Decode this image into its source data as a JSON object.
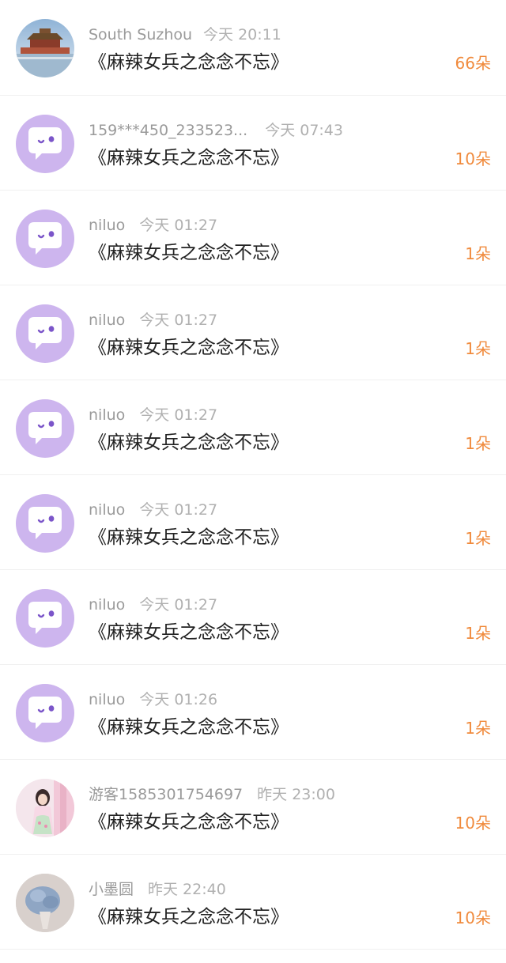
{
  "colors": {
    "amount": "#f08a3c",
    "default_avatar": "#cdb5ee",
    "username": "#9a9a9a",
    "title": "#222222"
  },
  "rows": [
    {
      "avatar": "photo-forbidden-city",
      "user": "South Suzhou",
      "time": "今天 20:11",
      "title": "《麻辣女兵之念念不忘》",
      "amount": "66朵"
    },
    {
      "avatar": "default-chat-icon",
      "user": "159***450_233523...",
      "time": "今天 07:43",
      "title": "《麻辣女兵之念念不忘》",
      "amount": "10朵"
    },
    {
      "avatar": "default-chat-icon",
      "user": "niluo",
      "time": "今天 01:27",
      "title": "《麻辣女兵之念念不忘》",
      "amount": "1朵"
    },
    {
      "avatar": "default-chat-icon",
      "user": "niluo",
      "time": "今天 01:27",
      "title": "《麻辣女兵之念念不忘》",
      "amount": "1朵"
    },
    {
      "avatar": "default-chat-icon",
      "user": "niluo",
      "time": "今天 01:27",
      "title": "《麻辣女兵之念念不忘》",
      "amount": "1朵"
    },
    {
      "avatar": "default-chat-icon",
      "user": "niluo",
      "time": "今天 01:27",
      "title": "《麻辣女兵之念念不忘》",
      "amount": "1朵"
    },
    {
      "avatar": "default-chat-icon",
      "user": "niluo",
      "time": "今天 01:27",
      "title": "《麻辣女兵之念念不忘》",
      "amount": "1朵"
    },
    {
      "avatar": "default-chat-icon",
      "user": "niluo",
      "time": "今天 01:26",
      "title": "《麻辣女兵之念念不忘》",
      "amount": "1朵"
    },
    {
      "avatar": "photo-girl-pink",
      "user": "游客1585301754697",
      "time": "昨天 23:00",
      "title": "《麻辣女兵之念念不忘》",
      "amount": "10朵"
    },
    {
      "avatar": "photo-flower-bouquet",
      "user": "小墨圆",
      "time": "昨天 22:40",
      "title": "《麻辣女兵之念念不忘》",
      "amount": "10朵"
    }
  ]
}
